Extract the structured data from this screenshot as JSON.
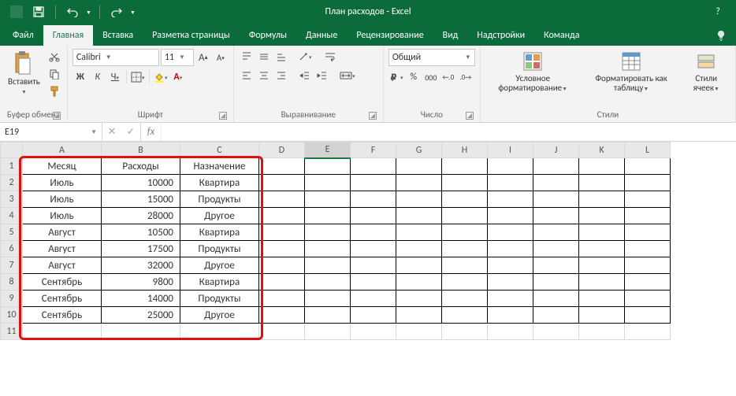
{
  "app": {
    "title": "План расходов - Excel"
  },
  "tabs": {
    "file": "Файл",
    "items": [
      "Главная",
      "Вставка",
      "Разметка страницы",
      "Формулы",
      "Данные",
      "Рецензирование",
      "Вид",
      "Надстройки",
      "Команда"
    ],
    "active": 0
  },
  "ribbon": {
    "clipboard": {
      "paste": "Вставить",
      "label": "Буфер обмена"
    },
    "font": {
      "name": "Calibri",
      "size": "11",
      "bold": "Ж",
      "italic": "К",
      "underline": "Ч",
      "label": "Шрифт"
    },
    "alignment": {
      "label": "Выравнивание"
    },
    "number": {
      "format": "Общий",
      "label": "Число"
    },
    "styles": {
      "cond": "Условное форматирование",
      "table": "Форматировать как таблицу",
      "cell": "Стили ячеек",
      "label": "Стили"
    }
  },
  "formula": {
    "namebox": "E19"
  },
  "columns": [
    "A",
    "B",
    "C",
    "D",
    "E",
    "F",
    "G",
    "H",
    "I",
    "J",
    "K",
    "L"
  ],
  "rows": [
    1,
    2,
    3,
    4,
    5,
    6,
    7,
    8,
    9,
    10,
    11
  ],
  "table": {
    "headers": [
      "Месяц",
      "Расходы",
      "Назначение"
    ],
    "data": [
      [
        "Июль",
        "10000",
        "Квартира"
      ],
      [
        "Июль",
        "15000",
        "Продукты"
      ],
      [
        "Июль",
        "28000",
        "Другое"
      ],
      [
        "Август",
        "10500",
        "Квартира"
      ],
      [
        "Август",
        "17500",
        "Продукты"
      ],
      [
        "Август",
        "32000",
        "Другое"
      ],
      [
        "Сентябрь",
        "9800",
        "Квартира"
      ],
      [
        "Сентябрь",
        "14000",
        "Продукты"
      ],
      [
        "Сентябрь",
        "25000",
        "Другое"
      ]
    ]
  },
  "active_cell": {
    "col": "E",
    "row_visual": "none"
  }
}
